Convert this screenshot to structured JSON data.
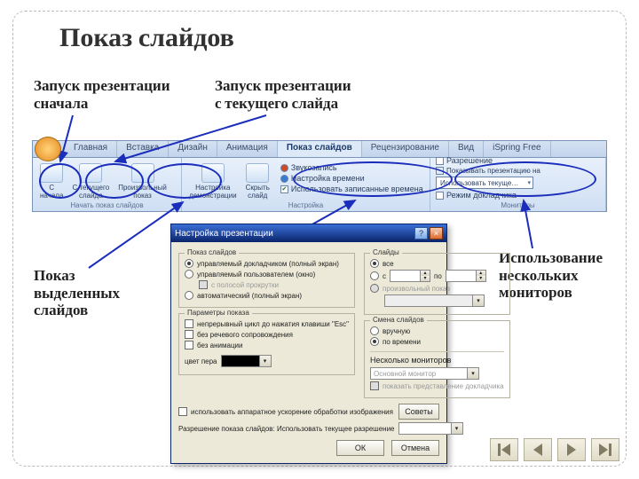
{
  "title": "Показ слайдов",
  "labels": {
    "top_left": "Запуск презентации\nсначала",
    "top_mid": "Запуск презентации\nс текущего слайда",
    "mid_left": "Показ\nвыделенных\nслайдов",
    "right": "Использование\nнескольких\nмониторов"
  },
  "ribbon": {
    "tabs": [
      "Главная",
      "Вставка",
      "Дизайн",
      "Анимация",
      "Показ слайдов",
      "Рецензирование",
      "Вид",
      "iSpring Free"
    ],
    "active_tab": "Показ слайдов",
    "group_start": {
      "label": "Начать показ слайдов",
      "btn_begin": "С\nначала",
      "btn_current": "С текущего\nслайда",
      "btn_custom": "Произвольный\nпоказ"
    },
    "group_setup": {
      "label": "Настройка",
      "btn_setup": "Настройка\nдемонстрации",
      "btn_hide": "Скрыть\nслайд",
      "chk_record": "Звукозапись",
      "chk_rehearse": "Настройка времени",
      "chk_use_timings": "Использовать записанные времена"
    },
    "group_monitors": {
      "label": "Мониторы",
      "chk_resolution": "Разрешение",
      "sel_monitor_label": "Показывать презентацию на",
      "sel_monitor_value": "Использовать текуще…",
      "chk_presenter": "Режим докладчика"
    }
  },
  "dialog": {
    "title": "Настройка презентации",
    "group_show_type": {
      "legend": "Показ слайдов",
      "r1": "управляемый докладчиком (полный экран)",
      "r2": "управляемый пользователем (окно)",
      "r2_chk": "с полосой прокрутки",
      "r3": "автоматический (полный экран)"
    },
    "group_slides": {
      "legend": "Слайды",
      "r_all": "все",
      "r_from": "с",
      "r_to": "по",
      "r_custom": "произвольный показ"
    },
    "group_options": {
      "legend": "Параметры показа",
      "c1": "непрерывный цикл до нажатия клавиши \"Esc\"",
      "c2": "без речевого сопровождения",
      "c3": "без анимации",
      "pen_label": "цвет пера"
    },
    "group_advance": {
      "legend": "Смена слайдов",
      "r_manual": "вручную",
      "r_timings": "по времени",
      "multi_legend": "Несколько мониторов",
      "multi_combo": "Основной монитор",
      "multi_chk": "показать представление докладчика"
    },
    "hw": {
      "chk": "использовать аппаратное ускорение обработки изображения",
      "tips": "Разрешение показа слайдов: Использовать текущее разрешение",
      "btn_tips": "Советы"
    },
    "buttons": {
      "ok": "ОК",
      "cancel": "Отмена"
    }
  }
}
